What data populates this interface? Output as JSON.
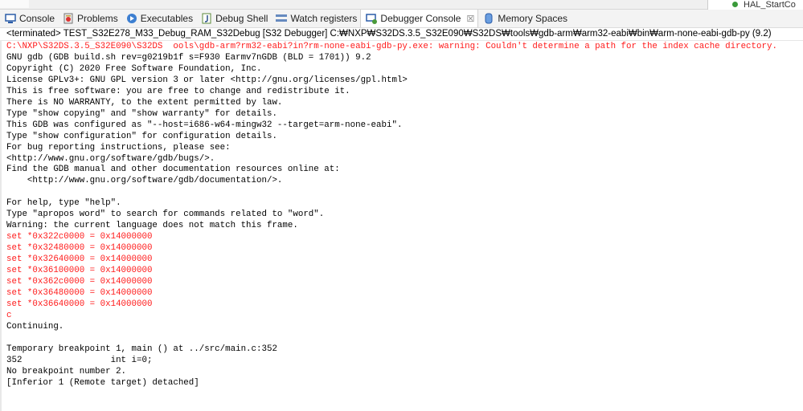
{
  "top_right_label": "HAL_StartCo",
  "tabs": [
    {
      "label": "Console",
      "icon": "console-icon",
      "active": false
    },
    {
      "label": "Problems",
      "icon": "problems-icon",
      "active": false
    },
    {
      "label": "Executables",
      "icon": "executables-icon",
      "active": false
    },
    {
      "label": "Debug Shell",
      "icon": "debug-shell-icon",
      "active": false
    },
    {
      "label": "Watch registers",
      "icon": "watch-registers-icon",
      "active": false
    },
    {
      "label": "Debugger Console",
      "icon": "debugger-console-icon",
      "active": true
    },
    {
      "label": "Memory Spaces",
      "icon": "memory-spaces-icon",
      "active": false
    }
  ],
  "status_line": "<terminated> TEST_S32E278_M33_Debug_RAM_S32Debug [S32 Debugger] C:₩NXP₩S32DS.3.5_S32E090₩S32DS₩tools₩gdb-arm₩arm32-eabi₩bin₩arm-none-eabi-gdb-py (9.2)",
  "colors": {
    "error": "#ff1a1a",
    "output": "#000000"
  },
  "console_lines": [
    {
      "text": "C:\\NXP\\S32DS.3.5_S32E090\\S32DS  ools\\gdb-arm?rm32-eabi?in?rm-none-eabi-gdb-py.exe: warning: Couldn't determine a path for the index cache directory.",
      "type": "err"
    },
    {
      "text": "GNU gdb (GDB build.sh rev=g0219b1f s=F930 Earmv7nGDB (BLD = 1701)) 9.2",
      "type": "out"
    },
    {
      "text": "Copyright (C) 2020 Free Software Foundation, Inc.",
      "type": "out"
    },
    {
      "text": "License GPLv3+: GNU GPL version 3 or later <http://gnu.org/licenses/gpl.html>",
      "type": "out"
    },
    {
      "text": "This is free software: you are free to change and redistribute it.",
      "type": "out"
    },
    {
      "text": "There is NO WARRANTY, to the extent permitted by law.",
      "type": "out"
    },
    {
      "text": "Type \"show copying\" and \"show warranty\" for details.",
      "type": "out"
    },
    {
      "text": "This GDB was configured as \"--host=i686-w64-mingw32 --target=arm-none-eabi\".",
      "type": "out"
    },
    {
      "text": "Type \"show configuration\" for configuration details.",
      "type": "out"
    },
    {
      "text": "For bug reporting instructions, please see:",
      "type": "out"
    },
    {
      "text": "<http://www.gnu.org/software/gdb/bugs/>.",
      "type": "out"
    },
    {
      "text": "Find the GDB manual and other documentation resources online at:",
      "type": "out"
    },
    {
      "text": "    <http://www.gnu.org/software/gdb/documentation/>.",
      "type": "out"
    },
    {
      "text": "",
      "type": "out"
    },
    {
      "text": "For help, type \"help\".",
      "type": "out"
    },
    {
      "text": "Type \"apropos word\" to search for commands related to \"word\".",
      "type": "out"
    },
    {
      "text": "Warning: the current language does not match this frame.",
      "type": "out"
    },
    {
      "text": "set *0x322c0000 = 0x14000000",
      "type": "err"
    },
    {
      "text": "set *0x32480000 = 0x14000000",
      "type": "err"
    },
    {
      "text": "set *0x32640000 = 0x14000000",
      "type": "err"
    },
    {
      "text": "set *0x36100000 = 0x14000000",
      "type": "err"
    },
    {
      "text": "set *0x362c0000 = 0x14000000",
      "type": "err"
    },
    {
      "text": "set *0x36480000 = 0x14000000",
      "type": "err"
    },
    {
      "text": "set *0x36640000 = 0x14000000",
      "type": "err"
    },
    {
      "text": "c",
      "type": "err"
    },
    {
      "text": "Continuing.",
      "type": "out"
    },
    {
      "text": "",
      "type": "out"
    },
    {
      "text": "Temporary breakpoint 1, main () at ../src/main.c:352",
      "type": "out"
    },
    {
      "text": "352                 int i=0;",
      "type": "out"
    },
    {
      "text": "No breakpoint number 2.",
      "type": "out"
    },
    {
      "text": "[Inferior 1 (Remote target) detached]",
      "type": "out"
    }
  ]
}
